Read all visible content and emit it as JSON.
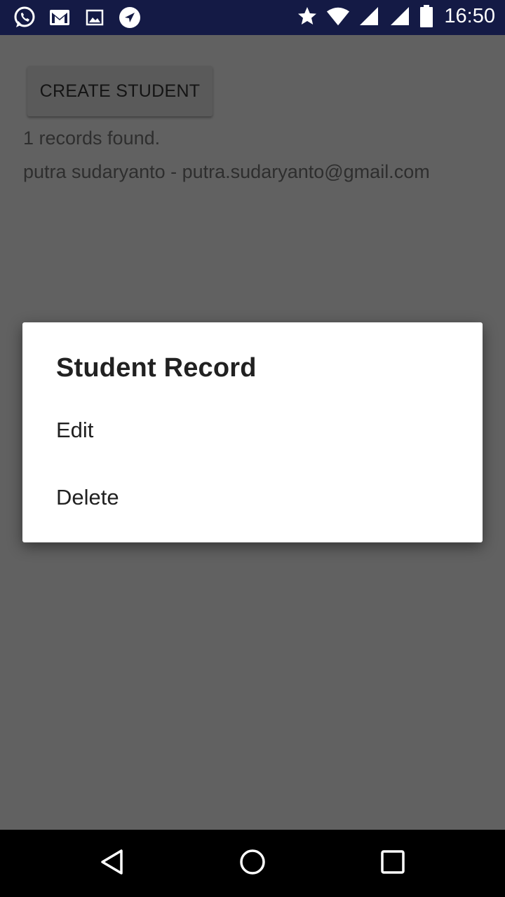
{
  "status_bar": {
    "time": "16:50",
    "left_icons": [
      "whatsapp-icon",
      "gmail-icon",
      "gallery-icon",
      "navigation-icon"
    ],
    "right_icons": [
      "star-icon",
      "wifi-icon",
      "signal-icon",
      "signal-icon",
      "battery-icon"
    ]
  },
  "main": {
    "create_button_label": "CREATE STUDENT",
    "records_text": "1 records found.",
    "students": [
      {
        "label": "putra sudaryanto - putra.sudaryanto@gmail.com"
      }
    ]
  },
  "dialog": {
    "title": "Student Record",
    "items": [
      {
        "label": "Edit"
      },
      {
        "label": "Delete"
      }
    ]
  },
  "nav_bar": {
    "buttons": [
      "back-icon",
      "home-icon",
      "recents-icon"
    ]
  },
  "colors": {
    "status_bar_bg": "#141a45",
    "scrim_bg": "#616161",
    "dialog_bg": "#ffffff",
    "nav_bar_bg": "#000000"
  }
}
